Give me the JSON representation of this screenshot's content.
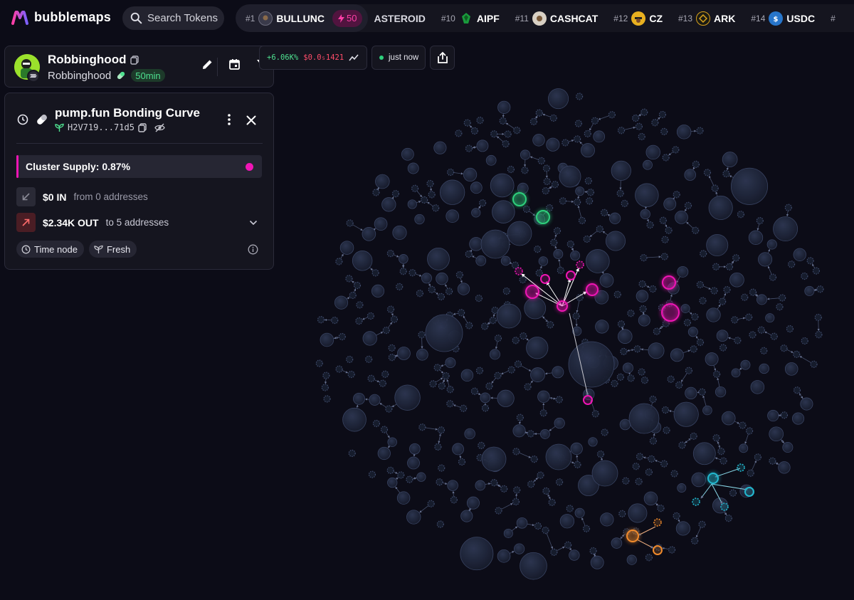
{
  "app": {
    "name": "bubblemaps"
  },
  "search": {
    "label": "Search Tokens"
  },
  "ticker": [
    {
      "rank": "#1",
      "name": "BULLUNC",
      "badge": "50",
      "color": "#3a3a4a"
    },
    {
      "rank": "",
      "name": "ASTEROID",
      "badge": "",
      "color": ""
    },
    {
      "rank": "#10",
      "name": "AIPF",
      "badge": "",
      "color": "#1a9a3c"
    },
    {
      "rank": "#11",
      "name": "CASHCAT",
      "badge": "",
      "color": "#d8d0c4"
    },
    {
      "rank": "#12",
      "name": "CZ",
      "badge": "",
      "color": "#e8b020"
    },
    {
      "rank": "#13",
      "name": "ARK",
      "badge": "",
      "color": "#d9a21c"
    },
    {
      "rank": "#14",
      "name": "USDC",
      "badge": "",
      "color": "#2775ca"
    }
  ],
  "token": {
    "title": "Robbinghood",
    "subtitle": "Robbinghood",
    "age": "50min"
  },
  "price": {
    "change": "+6.06K%",
    "value": "$0.0₅1421"
  },
  "update": {
    "label": "just now"
  },
  "panel": {
    "title": "pump.fun Bonding Curve",
    "address": "H2V719...71d5",
    "cluster_label": "Cluster Supply: 0.87%",
    "in_value": "$0 IN",
    "in_sub": "from 0 addresses",
    "out_value": "$2.34K OUT",
    "out_sub": "to 5 addresses",
    "tags": [
      "Time node",
      "Fresh"
    ]
  },
  "colors": {
    "background": "#0c0c17",
    "node_fill": "#1d2438",
    "node_stroke": "#3b4666",
    "magenta": "#f015b5",
    "green": "#2ecf7c",
    "cyan": "#22b8cf",
    "orange": "#f08a2c",
    "price_up": "#4ee08f",
    "price_value": "#ff4d6a"
  }
}
